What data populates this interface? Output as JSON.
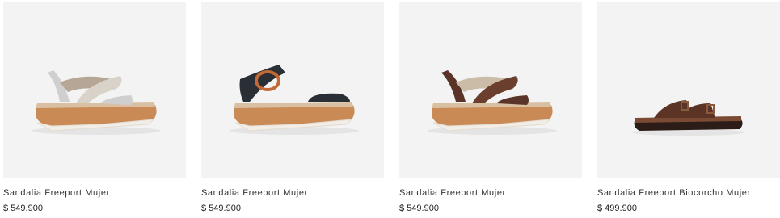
{
  "products": [
    {
      "name": "Sandalia Freeport Mujer",
      "price": "$ 549.900",
      "image_icon": "wedge-sandal-image",
      "colors": {
        "strap_front": "#d8d2c8",
        "strap_back": "#b6a696",
        "accent": "#cfcfcf",
        "sole": "#c98a55",
        "outsole": "#f2ede6"
      }
    },
    {
      "name": "Sandalia Freeport Mujer",
      "price": "$ 549.900",
      "image_icon": "wedge-sandal-buckle-image",
      "colors": {
        "strap_front": "#2a2e35",
        "strap_back": "#2a2e35",
        "accent": "#c26a35",
        "sole": "#c98a55",
        "outsole": "#f2ede6"
      }
    },
    {
      "name": "Sandalia Freeport Mujer",
      "price": "$ 549.900",
      "image_icon": "wedge-sandal-image",
      "colors": {
        "strap_front": "#6a3f2e",
        "strap_back": "#cbbca8",
        "accent": "#5a3426",
        "sole": "#c98a55",
        "outsole": "#f2ede6"
      }
    },
    {
      "name": "Sandalia Freeport Biocorcho Mujer",
      "price": "$ 499.900",
      "image_icon": "slide-sandal-image",
      "colors": {
        "strap_front": "#5b3426",
        "strap_back": "#5b3426",
        "accent": "#8a5a3e",
        "sole": "#7a4a34",
        "outsole": "#2b1c17"
      }
    }
  ]
}
